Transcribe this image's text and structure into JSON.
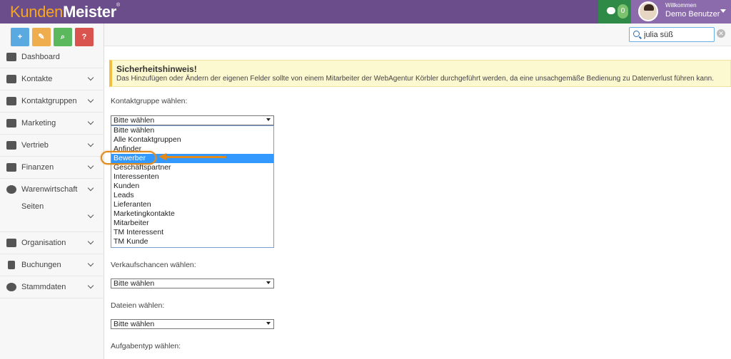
{
  "app": {
    "logo_part1": "Kunden",
    "logo_part2": "Meister",
    "logo_mark": "®"
  },
  "header": {
    "message_count": "0",
    "welcome": "Willkommen",
    "username": "Demo Benutzer"
  },
  "quick_actions": [
    {
      "label": "+",
      "icon": "plus-icon"
    },
    {
      "label": "✎",
      "icon": "comment-icon"
    },
    {
      "label": "⌕",
      "icon": "search-icon"
    },
    {
      "label": "?",
      "icon": "help-icon"
    }
  ],
  "sidebar": {
    "items": [
      {
        "label": "Dashboard",
        "icon": "dashboard-icon"
      },
      {
        "label": "Kontakte",
        "icon": "user-icon"
      },
      {
        "label": "Kontaktgruppen",
        "icon": "users-icon"
      },
      {
        "label": "Marketing",
        "icon": "envelope-icon"
      },
      {
        "label": "Vertrieb",
        "icon": "bar-chart-icon"
      },
      {
        "label": "Finanzen",
        "icon": "money-icon"
      },
      {
        "label": "Warenwirtschaft",
        "icon": "globe-icon"
      },
      {
        "label": "Seiten",
        "icon": ""
      },
      {
        "label": "Organisation",
        "icon": "edit-icon"
      },
      {
        "label": "Buchungen",
        "icon": "bookmark-icon"
      },
      {
        "label": "Stammdaten",
        "icon": "cogs-icon"
      }
    ]
  },
  "search": {
    "value": "julia süß",
    "clear": "✕"
  },
  "warning": {
    "title": "Sicherheitshinweis!",
    "text": "Das Hinzufügen oder Ändern der eigenen Felder sollte von einem Mitarbeiter der WebAgentur Körbler durchgeführt werden, da eine unsachgemäße Bedienung zu Datenverlust führen kann."
  },
  "form": {
    "kontaktgruppe_label": "Kontaktgruppe wählen:",
    "kontaktgruppe_value": "Bitte wählen",
    "kontaktgruppe_options": [
      "Bitte wählen",
      "Alle Kontaktgruppen",
      "Anfinder",
      "Bewerber",
      "Geschäftspartner",
      "Interessenten",
      "Kunden",
      "Leads",
      "Lieferanten",
      "Marketingkontakte",
      "Mitarbeiter",
      "TM Interessent",
      "TM Kunde"
    ],
    "kontaktgruppe_selected_index": 3,
    "verkaufschancen_label": "Verkaufschancen wählen:",
    "verkaufschancen_value": "Bitte wählen",
    "dateien_label": "Dateien wählen:",
    "dateien_value": "Bitte wählen",
    "aufgabentyp_label": "Aufgabentyp wählen:"
  }
}
